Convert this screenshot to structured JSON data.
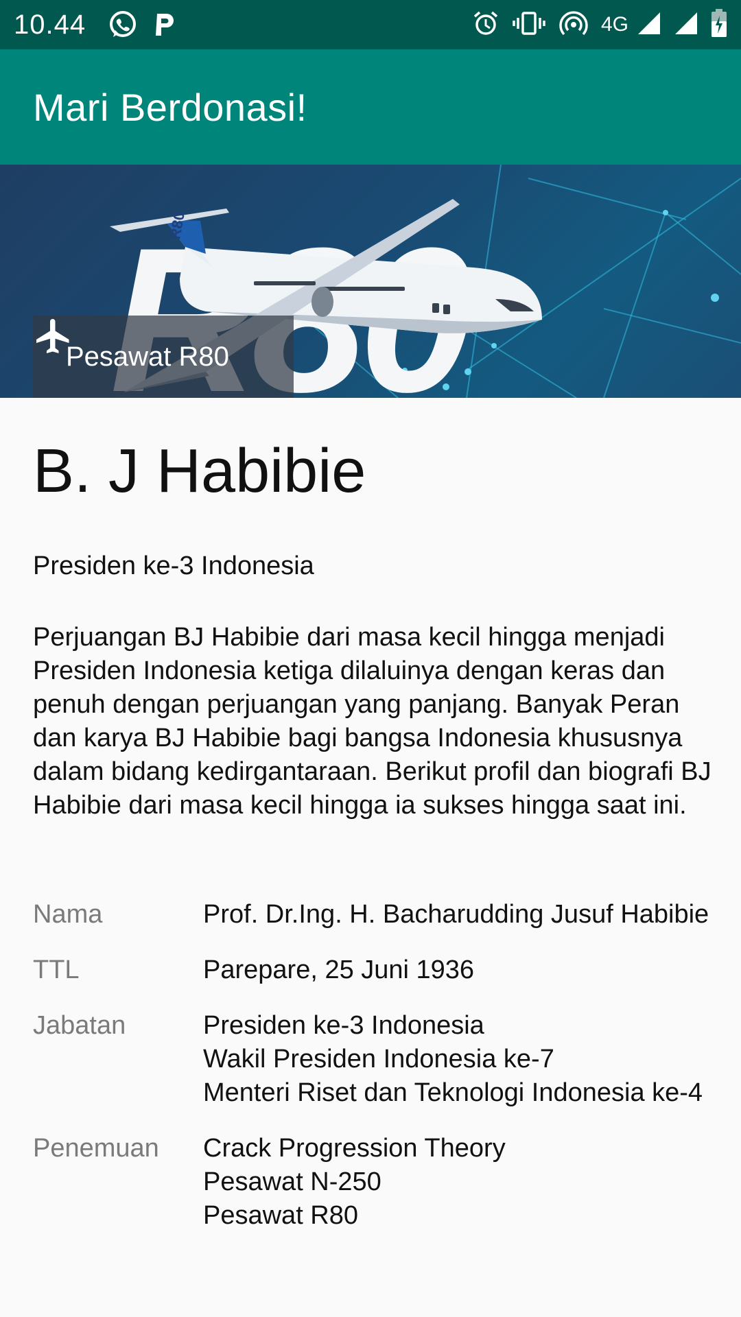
{
  "status_bar": {
    "time": "10.44",
    "network": "4G",
    "icons": [
      "whatsapp-icon",
      "parking-app-icon",
      "alarm-icon",
      "vibrate-icon",
      "hotspot-icon",
      "signal-icon",
      "signal-icon",
      "battery-charging-icon"
    ]
  },
  "app_bar": {
    "title": "Mari Berdonasi!"
  },
  "hero": {
    "badge_icon": "airplane-icon",
    "badge_label": "Pesawat R80",
    "logo_text": "R80",
    "fuselage_text": "R80"
  },
  "profile": {
    "name": "B. J Habibie",
    "subtitle": "Presiden ke-3 Indonesia",
    "description": "Perjuangan BJ Habibie dari masa kecil hingga menjadi Presiden Indonesia ketiga dilaluinya dengan keras dan penuh dengan perjuangan yang panjang. Banyak Peran dan karya BJ Habibie bagi bangsa Indonesia khususnya dalam bidang kedirgantaraan. Berikut profil dan biografi BJ Habibie dari masa kecil hingga ia sukses hingga saat ini.",
    "info": [
      {
        "label": "Nama",
        "value": "Prof. Dr.Ing. H. Bacharudding Jusuf Habibie"
      },
      {
        "label": "TTL",
        "value": "Parepare, 25 Juni 1936"
      },
      {
        "label": "Jabatan",
        "value": "Presiden ke-3 Indonesia\n Wakil Presiden Indonesia ke-7\n Menteri Riset dan Teknologi Indonesia ke-4"
      },
      {
        "label": "Penemuan",
        "value": "Crack Progression Theory\n Pesawat N-250\n Pesawat R80"
      }
    ]
  },
  "colors": {
    "status_bar": "#00584f",
    "app_bar": "#00857a",
    "background": "#fafafa",
    "label_gray": "#7a7a7a"
  }
}
